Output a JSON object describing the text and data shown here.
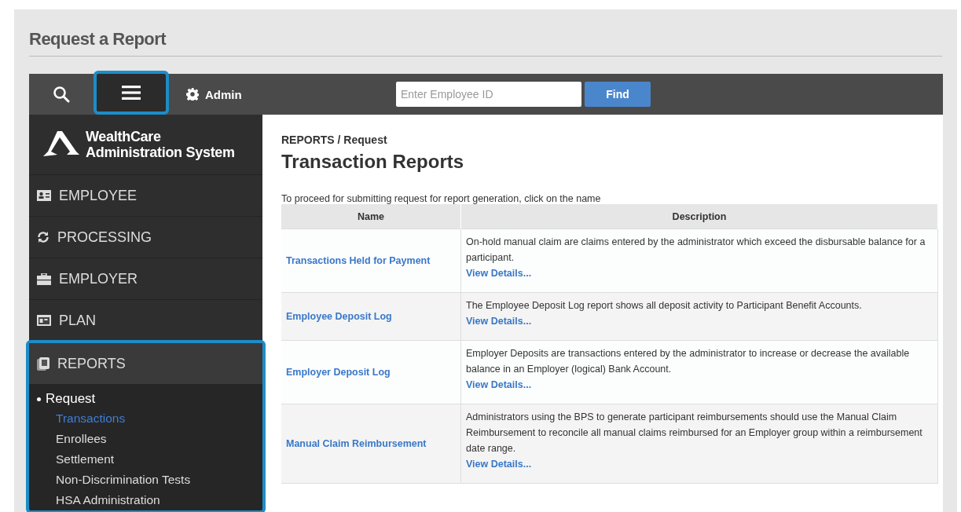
{
  "page_title": "Request a Report",
  "topbar": {
    "menu_highlighted": true,
    "admin_label": "Admin",
    "search": {
      "placeholder": "Enter Employee ID"
    },
    "find_button": "Find"
  },
  "logo": {
    "line_1": "WealthCare",
    "line_2": "Administration System"
  },
  "sidebar": {
    "items": [
      {
        "label": "EMPLOYEE",
        "kind": "employee",
        "expanded": false,
        "highlighted": false
      },
      {
        "label": "PROCESSING",
        "kind": "processing",
        "expanded": false,
        "highlighted": false
      },
      {
        "label": "EMPLOYER",
        "kind": "employer",
        "expanded": false,
        "highlighted": false
      },
      {
        "label": "PLAN",
        "kind": "plan",
        "expanded": false,
        "highlighted": false
      },
      {
        "label": "REPORTS",
        "kind": "reports",
        "expanded": true,
        "highlighted": true,
        "children": [
          {
            "label": "Request",
            "children": [
              {
                "label": "Transactions",
                "selected": true
              },
              {
                "label": "Enrollees",
                "selected": false
              },
              {
                "label": "Settlement",
                "selected": false
              },
              {
                "label": "Non-Discrimination Tests",
                "selected": false
              },
              {
                "label": "HSA Administration",
                "selected": false
              }
            ]
          }
        ]
      }
    ]
  },
  "breadcrumb": "REPORTS / Request",
  "heading": "Transaction Reports",
  "instruction": "To proceed for submitting request for report generation, click on the name",
  "table": {
    "columns": [
      "Name",
      "Description"
    ],
    "rows": [
      {
        "name": "Transactions Held for Payment",
        "description": "On-hold manual claim are claims entered by the administrator which exceed the disbursable balance for a participant.",
        "link": "View Details..."
      },
      {
        "name": "Employee Deposit Log",
        "description": "The Employee Deposit Log report shows all deposit activity to Participant Benefit Accounts.",
        "link": "View Details..."
      },
      {
        "name": "Employer Deposit Log",
        "description": "Employer Deposits are transactions entered by the administrator to increase or decrease the available balance in an Employer (logical) Bank Account.",
        "link": "View Details..."
      },
      {
        "name": "Manual Claim Reimbursement",
        "description": "Administrators using the BPS to generate participant reimbursements should use the Manual Claim Reimbursement to reconcile all manual claims reimbursed for an Employer group within a reimbursement date range.",
        "link": "View Details..."
      }
    ]
  }
}
